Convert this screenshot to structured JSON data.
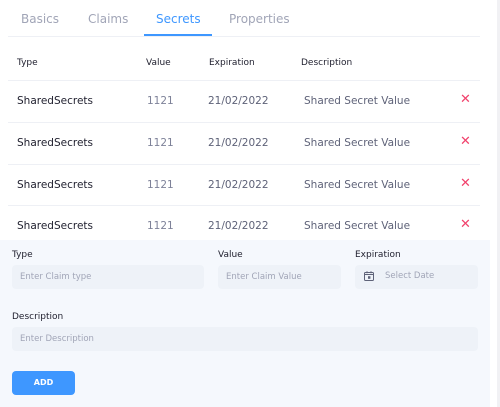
{
  "tabs": [
    {
      "label": "Basics"
    },
    {
      "label": "Claims"
    },
    {
      "label": "Secrets"
    },
    {
      "label": "Properties"
    }
  ],
  "active_tab": "Secrets",
  "table": {
    "headers": {
      "type": "Type",
      "value": "Value",
      "expiration": "Expiration",
      "description": "Description"
    },
    "rows": [
      {
        "type": "SharedSecrets",
        "value": "1121",
        "expiration": "21/02/2022",
        "description": "Shared Secret Value"
      },
      {
        "type": "SharedSecrets",
        "value": "1121",
        "expiration": "21/02/2022",
        "description": "Shared Secret Value"
      },
      {
        "type": "SharedSecrets",
        "value": "1121",
        "expiration": "21/02/2022",
        "description": "Shared Secret Value"
      },
      {
        "type": "SharedSecrets",
        "value": "1121",
        "expiration": "21/02/2022",
        "description": "Shared Secret Value"
      }
    ],
    "delete_glyph": "✕"
  },
  "form": {
    "type_label": "Type",
    "type_placeholder": "Enter Claim type",
    "value_label": "Value",
    "value_placeholder": "Enter Claim Value",
    "expiration_label": "Expiration",
    "date_placeholder": "Select Date",
    "description_label": "Description",
    "description_placeholder": "Enter Description",
    "add_label": "ADD"
  },
  "icons": {
    "delete": "close-icon",
    "calendar": "calendar-icon"
  },
  "colors": {
    "accent": "#3e97ff",
    "danger": "#f1416c",
    "form_background": "#f5f8fd"
  }
}
